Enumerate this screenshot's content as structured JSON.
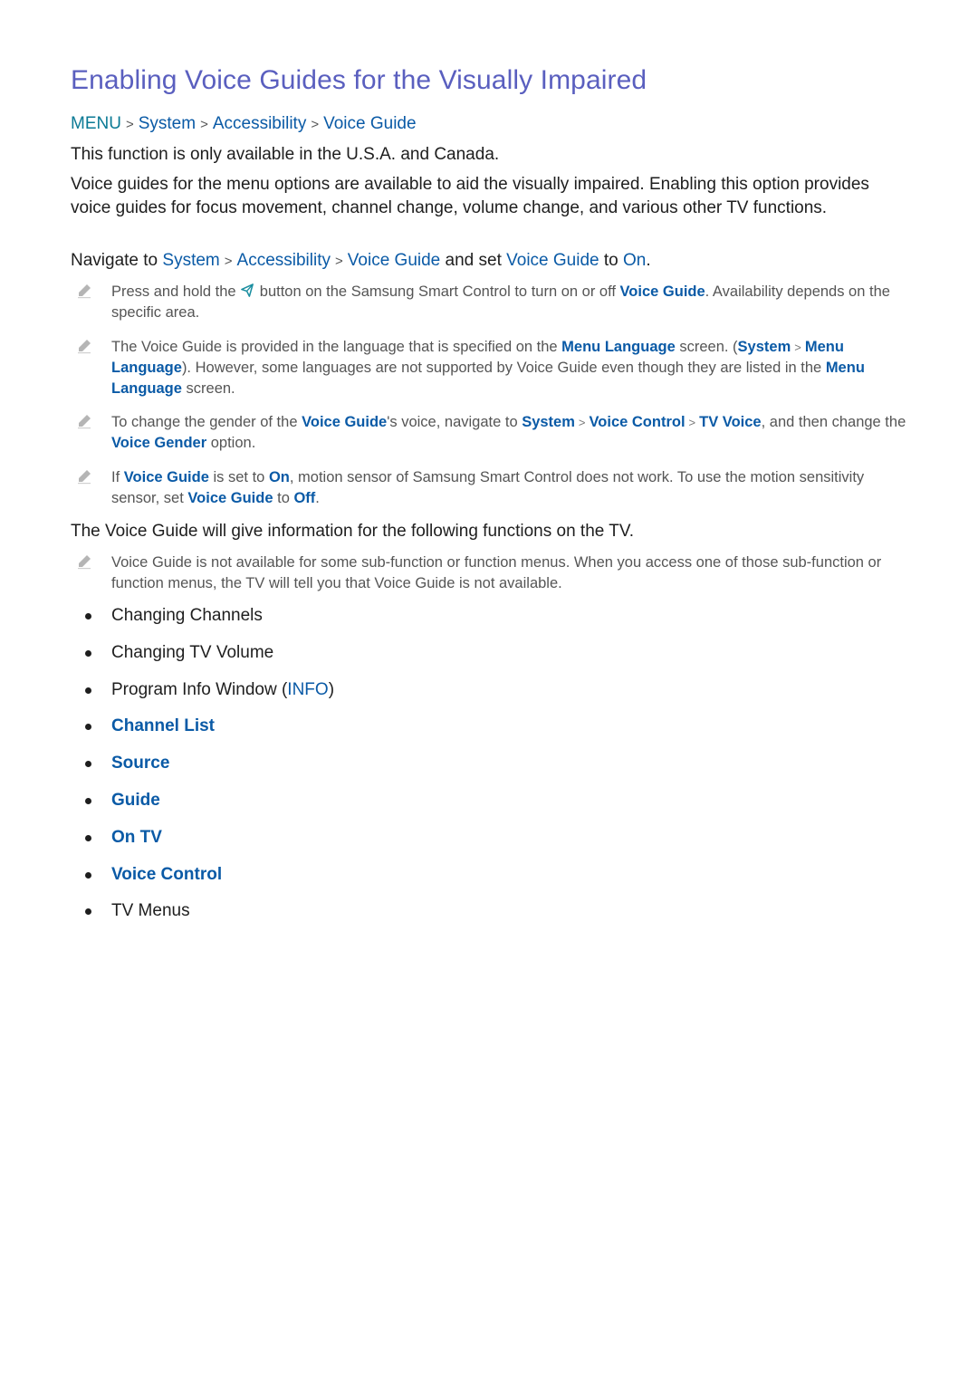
{
  "title": "Enabling Voice Guides for the Visually Impaired",
  "breadcrumb": [
    "MENU",
    "System",
    "Accessibility",
    "Voice Guide"
  ],
  "availability": "This function is only available in the U.S.A. and Canada.",
  "intro": "Voice guides for the menu options are available to aid the visually impaired. Enabling this option provides voice guides for focus movement, channel change, volume change, and various other TV functions.",
  "navigate": {
    "prefix": "Navigate to ",
    "path": [
      "System",
      "Accessibility",
      "Voice Guide"
    ],
    "mid": " and set ",
    "setting": "Voice Guide",
    "to": " to ",
    "value": "On",
    "end": "."
  },
  "notes": [
    {
      "icon": "pencil-note-icon",
      "parts": {
        "a": "Press and hold the ",
        "remote_icon": "voice-button-icon",
        "b": " button on the Samsung Smart Control to turn on or off ",
        "c": "Voice Guide",
        "d": ". Availability depends on the specific area."
      }
    },
    {
      "icon": "pencil-note-icon",
      "parts": {
        "a": "The Voice Guide is provided in the language that is specified on the ",
        "b": "Menu Language",
        "c": " screen. (",
        "d": "System",
        "e": "Menu Language",
        "f": "). However, some languages are not supported by Voice Guide even though they are listed in the ",
        "g": "Menu Language",
        "h": " screen."
      }
    },
    {
      "icon": "pencil-note-icon",
      "parts": {
        "a": "To change the gender of the ",
        "b": "Voice Guide",
        "c": "'s voice, navigate to ",
        "d": "System",
        "e": "Voice Control",
        "f": "TV Voice",
        "g": ", and then change the ",
        "h": "Voice Gender",
        "i": " option."
      }
    },
    {
      "icon": "pencil-note-icon",
      "parts": {
        "a": "If ",
        "b": "Voice Guide",
        "c": " is set to ",
        "d": "On",
        "e": ", motion sensor of Samsung Smart Control does not work. To use the motion sensitivity sensor, set ",
        "f": "Voice Guide",
        "g": " to ",
        "h": "Off",
        "i": "."
      }
    }
  ],
  "functions_intro": "The Voice Guide will give information for the following functions on the TV.",
  "functions_note": "Voice Guide is not available for some sub-function or function menus. When you access one of those sub-function or function menus, the TV will tell you that Voice Guide is not available.",
  "functions": [
    {
      "label": "Changing Channels",
      "link": false
    },
    {
      "label": "Changing TV Volume",
      "link": false
    },
    {
      "label": "Program Info Window (",
      "extra": "INFO",
      "tail": ")",
      "link": false
    },
    {
      "label": "Channel List",
      "link": true
    },
    {
      "label": "Source",
      "link": true
    },
    {
      "label": "Guide",
      "link": true
    },
    {
      "label": "On TV",
      "link": true
    },
    {
      "label": "Voice Control",
      "link": true
    },
    {
      "label": "TV Menus",
      "link": false
    }
  ],
  "colors": {
    "title": "#5a5fbf",
    "menu": "#0b7a95",
    "link": "#0a5aa6",
    "body": "#1e1e1e",
    "note": "#555555"
  }
}
